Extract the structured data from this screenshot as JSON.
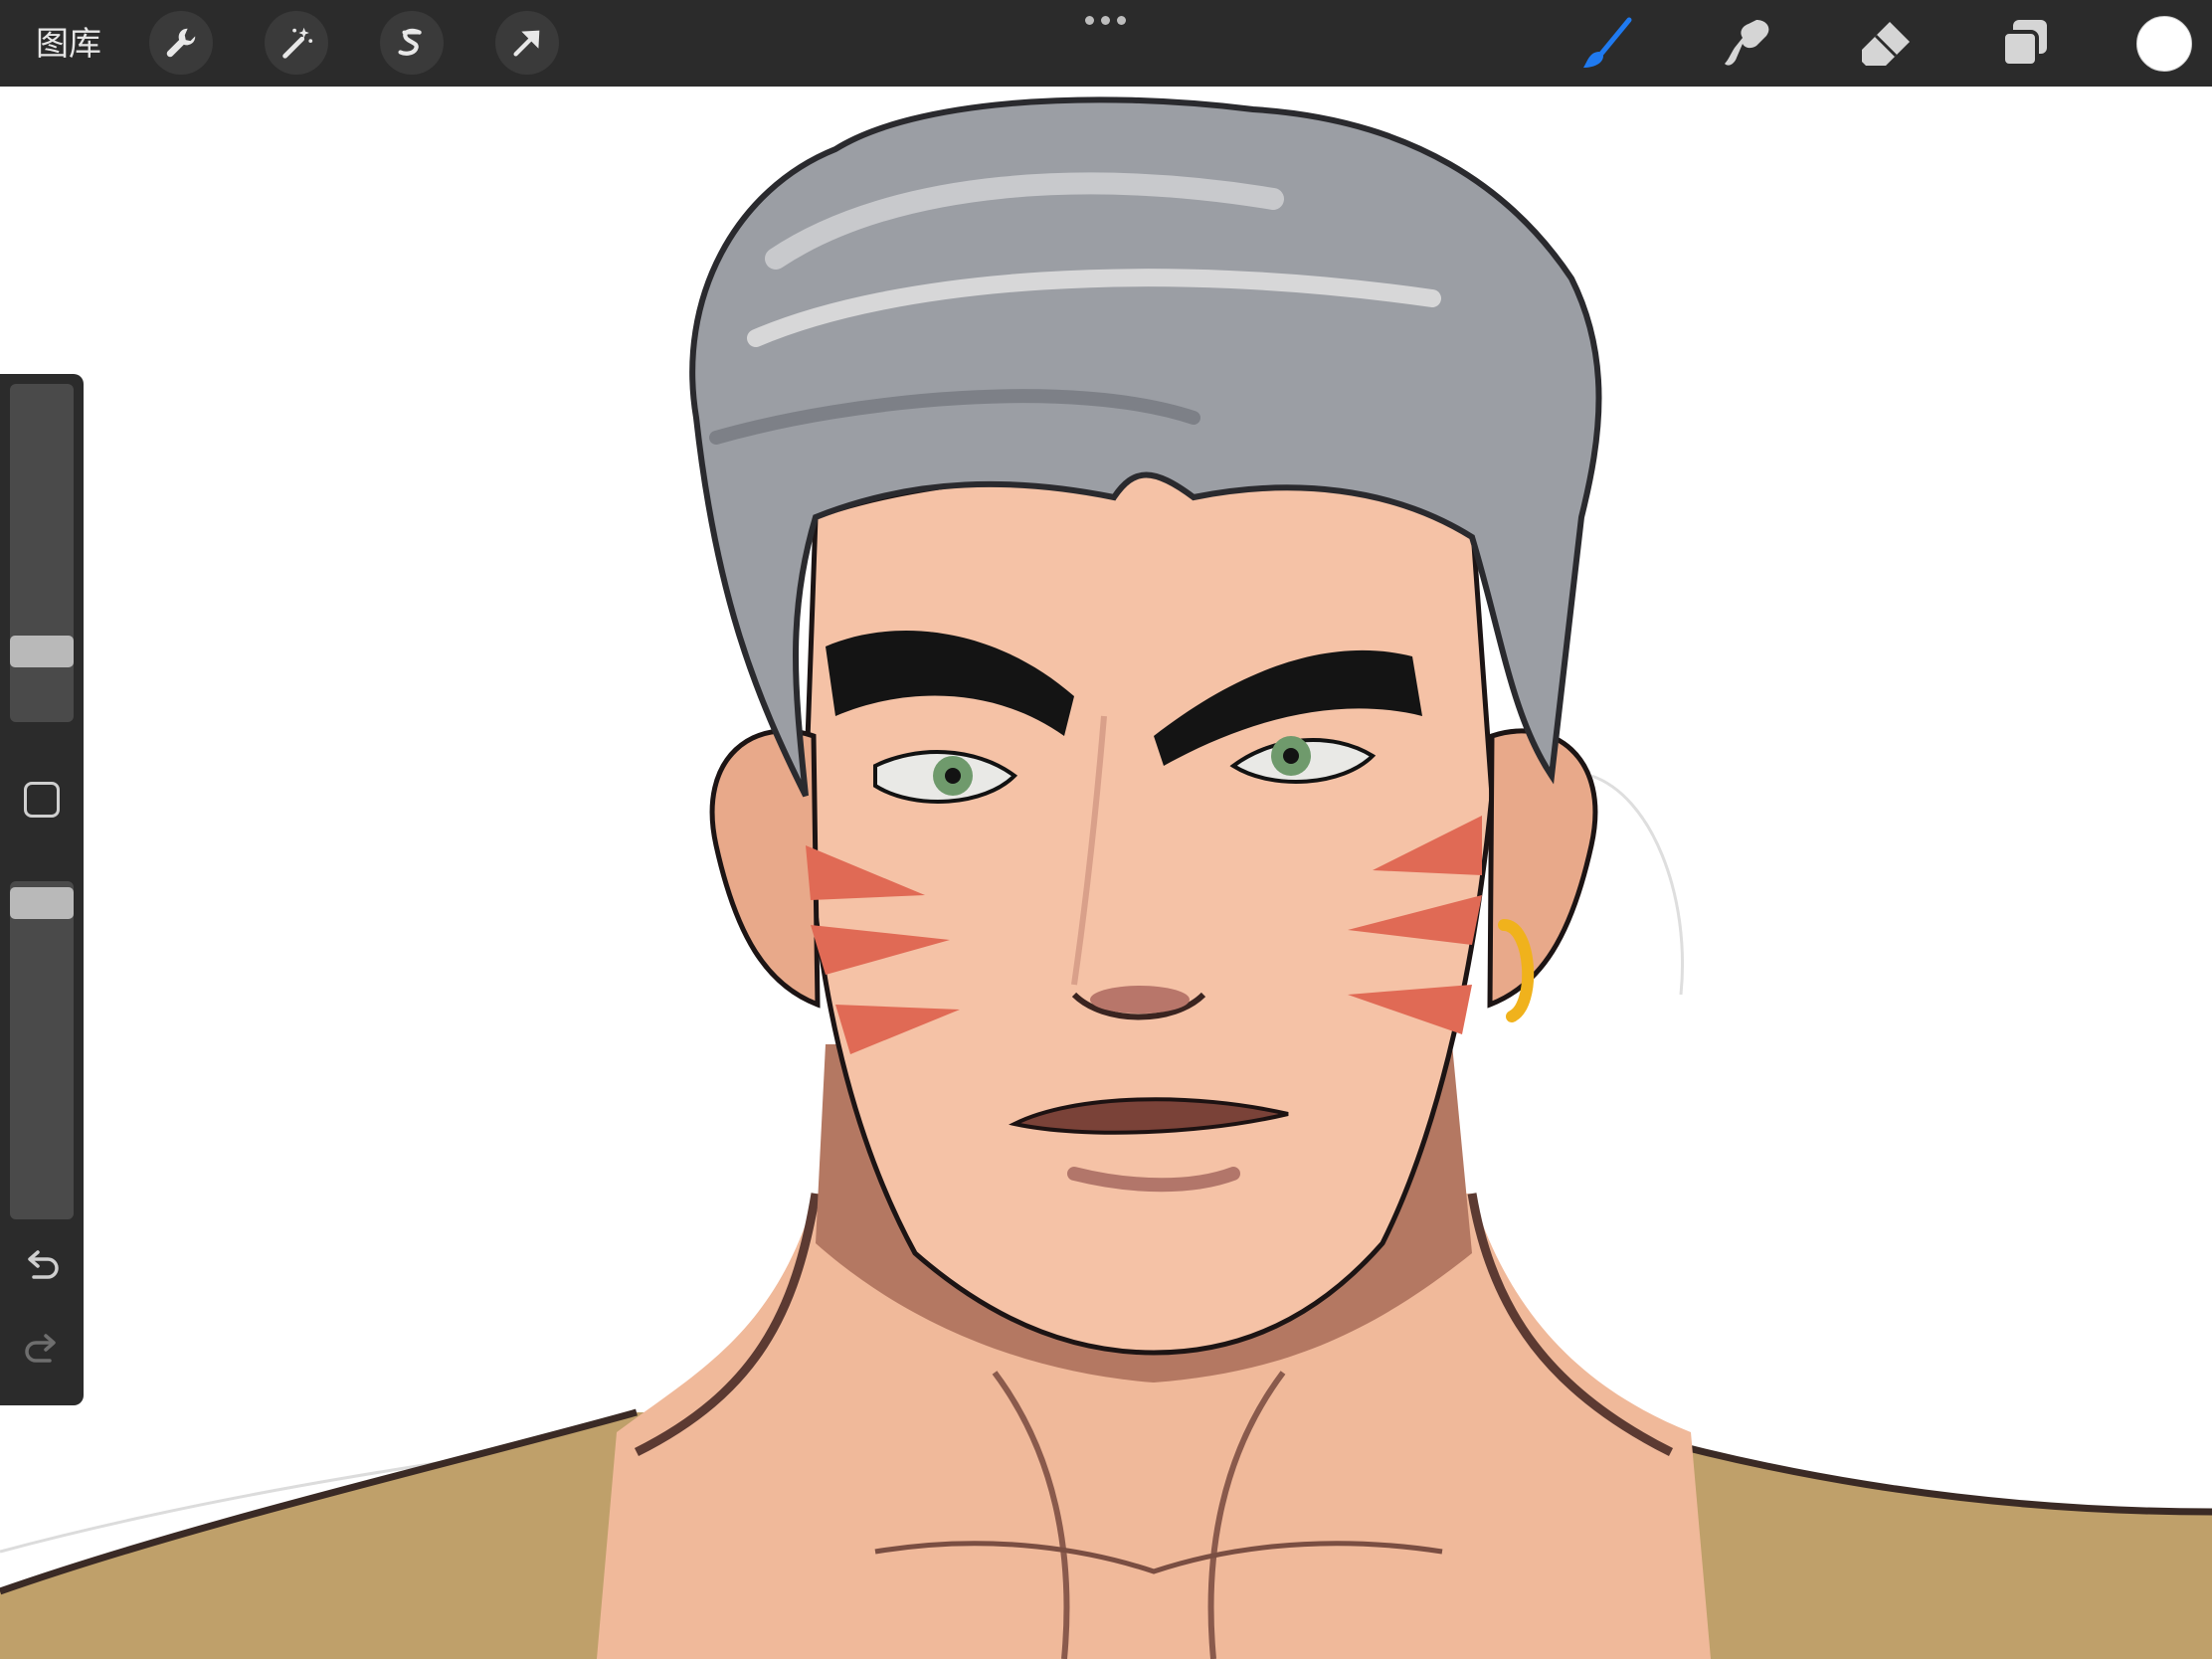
{
  "toolbar": {
    "gallery_label": "图库",
    "left_tools": [
      "wrench-icon",
      "magic-wand-icon",
      "selection-s-icon",
      "arrow-move-icon"
    ],
    "right_tools": [
      "brush-icon",
      "smudge-icon",
      "eraser-icon",
      "layers-icon"
    ],
    "active_tool": "brush",
    "active_color": "#ffffff",
    "accent_color": "#1f7af0"
  },
  "sidebar": {
    "brush_size_level": 0.18,
    "opacity_level": 0.98,
    "modify_icon": "square-icon",
    "undo_icon": "undo-icon",
    "redo_icon": "redo-icon"
  },
  "canvas": {
    "content": "digital-painting-portrait"
  }
}
